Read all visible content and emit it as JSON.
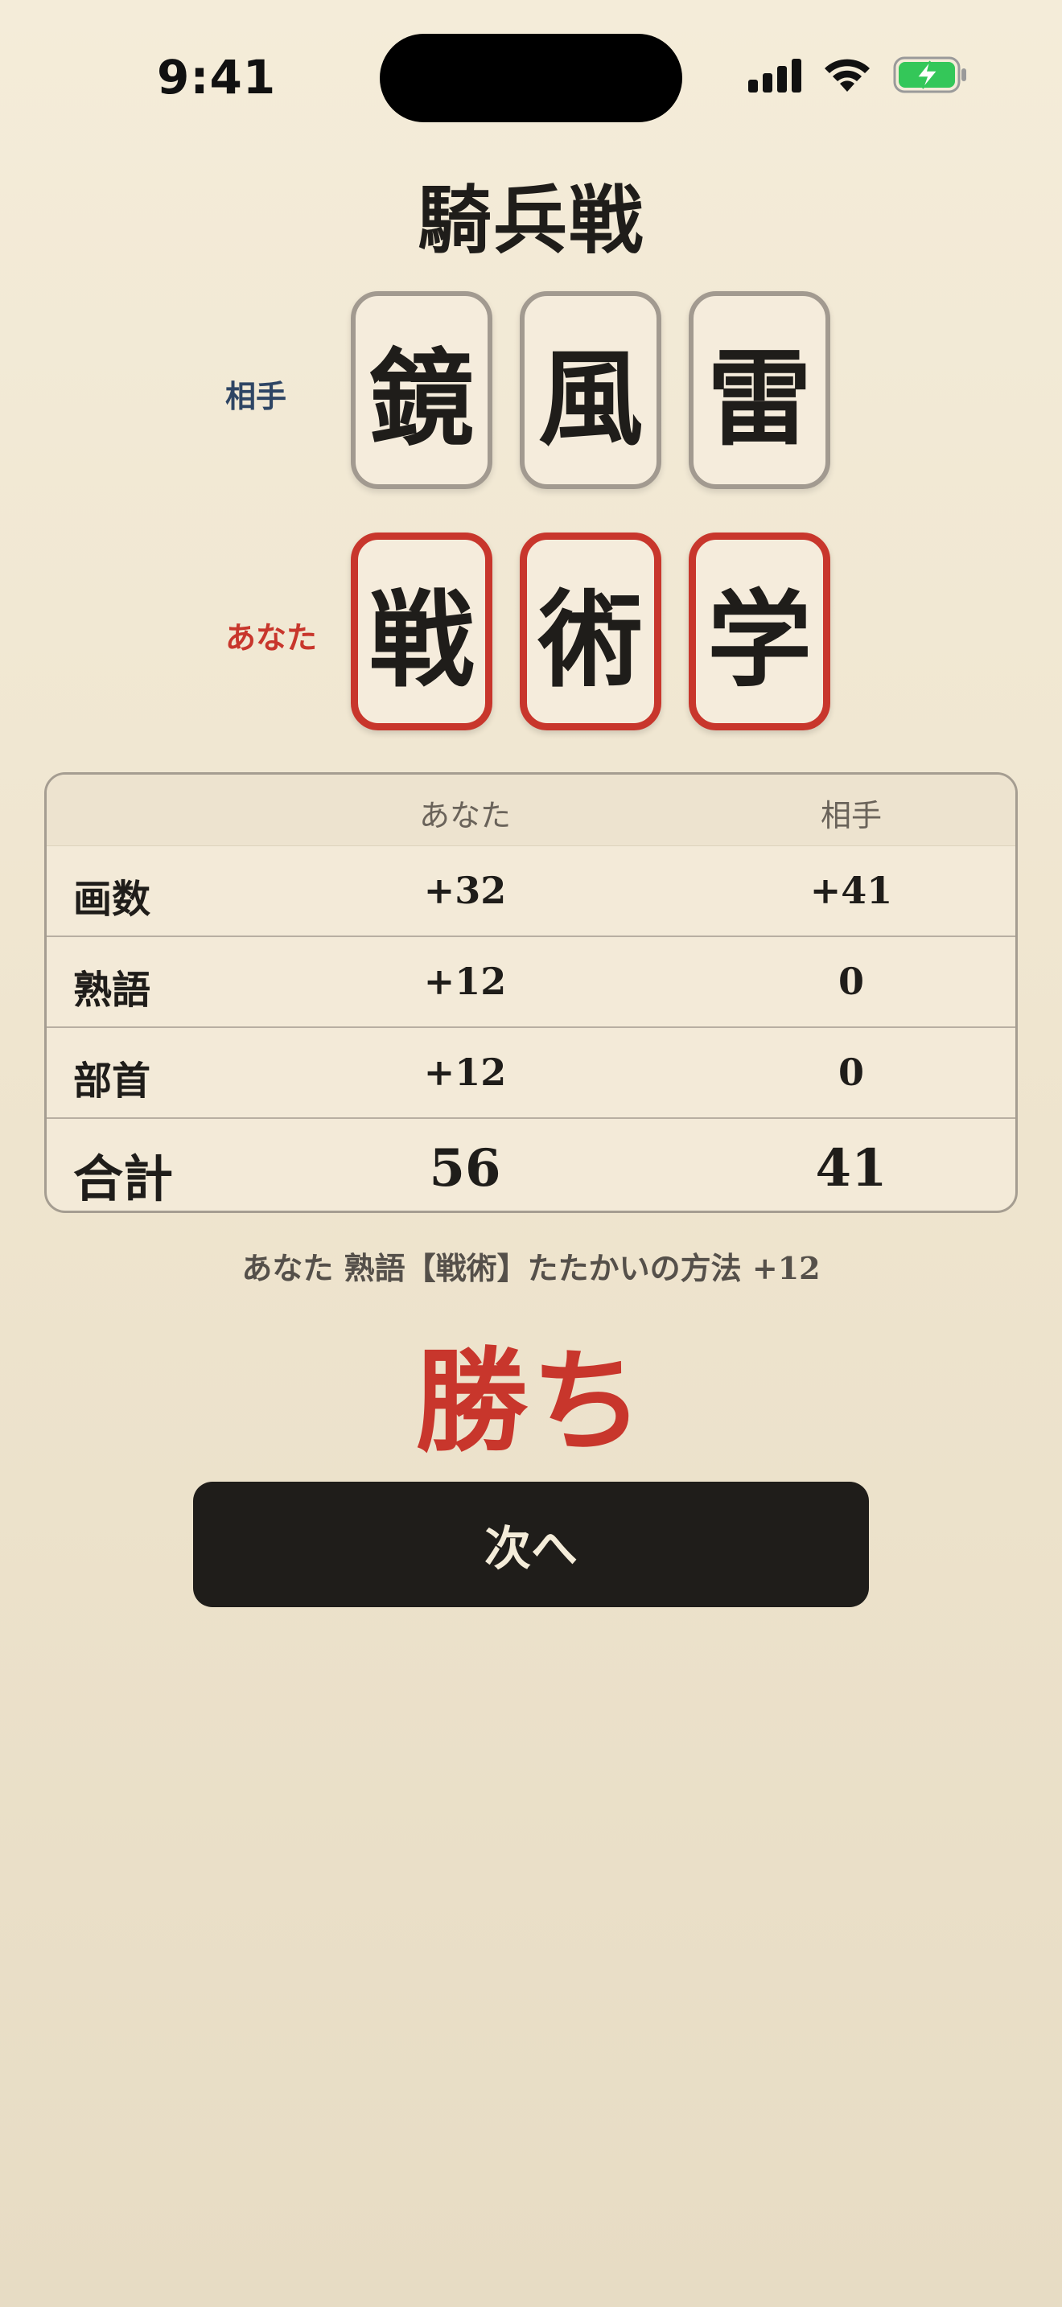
{
  "status_bar": {
    "time": "9:41",
    "icons": [
      "cellular-signal-icon",
      "wifi-icon",
      "battery-charging-icon"
    ],
    "battery_color": "#34c759"
  },
  "game": {
    "title": "騎兵戦"
  },
  "hands": {
    "opponent": {
      "label": "相手",
      "label_color": "#2e4564",
      "tiles": [
        "鏡",
        "風",
        "雷"
      ]
    },
    "you": {
      "label": "あなた",
      "label_color": "#c8362c",
      "tiles": [
        "戦",
        "術",
        "学"
      ]
    }
  },
  "score_table": {
    "columns": [
      "",
      "あなた",
      "相手"
    ],
    "rows": [
      {
        "label": "画数",
        "you": "+32",
        "opponent": "+41"
      },
      {
        "label": "熟語",
        "you": "+12",
        "opponent": "0"
      },
      {
        "label": "部首",
        "you": "+12",
        "opponent": "0"
      }
    ],
    "total": {
      "label": "合計",
      "you": "56",
      "opponent": "41"
    }
  },
  "combo_note": "あなた 熟語【戦術】たたかいの方法 +12",
  "result": {
    "text": "勝ち",
    "color": "#c8362c"
  },
  "next_button": {
    "label": "次へ"
  }
}
